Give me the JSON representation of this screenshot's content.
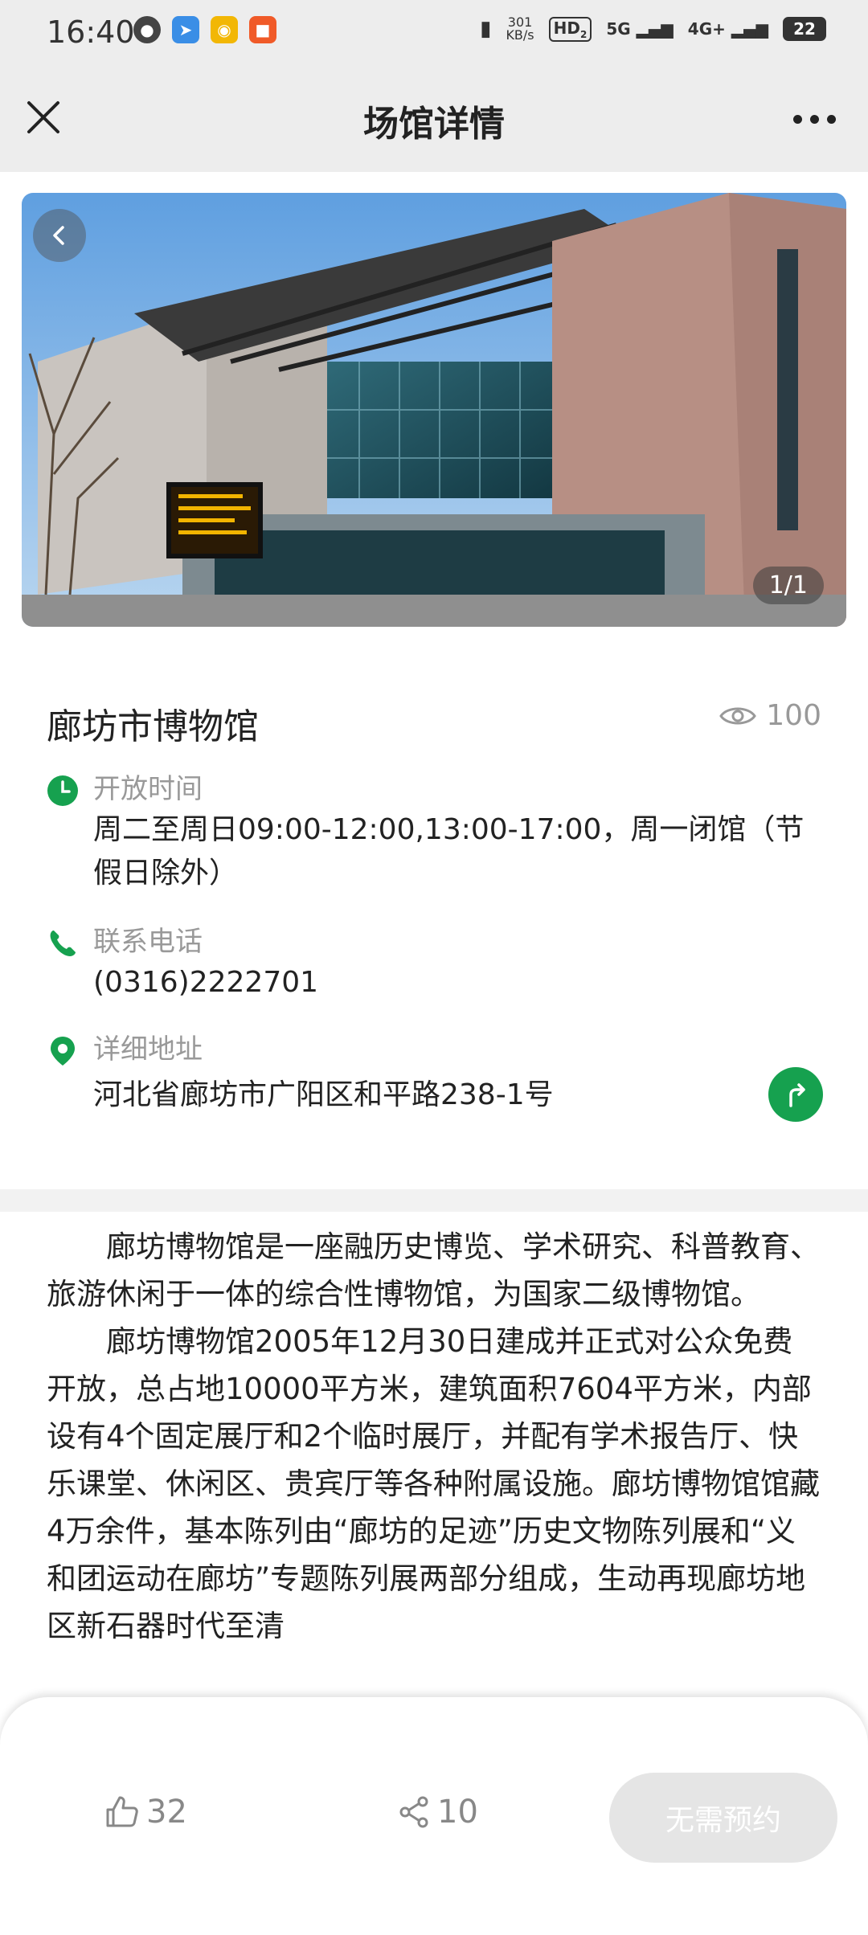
{
  "status_bar": {
    "time": "16:40",
    "net_speed_value": "301",
    "net_speed_unit": "KB/s",
    "hd_label": "HD",
    "hd_sub": "2",
    "sig1": "5G",
    "sig2": "4G+",
    "battery": "22"
  },
  "nav": {
    "title": "场馆详情"
  },
  "hero": {
    "counter": "1/1"
  },
  "venue": {
    "name": "廊坊市博物馆",
    "views": "100",
    "hours_label": "开放时间",
    "hours_value": "周二至周日09:00-12:00,13:00-17:00，周一闭馆（节假日除外）",
    "phone_label": "联系电话",
    "phone_value": "(0316)2222701",
    "address_label": "详细地址",
    "address_value": "河北省廊坊市广阳区和平路238-1号"
  },
  "description": {
    "p1": "廊坊博物馆是一座融历史博览、学术研究、科普教育、旅游休闲于一体的综合性博物馆，为国家二级博物馆。",
    "p2": "廊坊博物馆2005年12月30日建成并正式对公众免费开放，总占地10000平方米，建筑面积7604平方米，内部设有4个固定展厅和2个临时展厅，并配有学术报告厅、快乐课堂、休闲区、贵宾厅等各种附属设施。廊坊博物馆馆藏4万余件，基本陈列由“廊坊的足迹”历史文物陈列展和“义和团运动在廊坊”专题陈列展两部分组成，生动再现廊坊地区新石器时代至清"
  },
  "bottom": {
    "likes": "32",
    "shares": "10",
    "reserve": "无需预约"
  },
  "colors": {
    "accent_green": "#16a14f",
    "nav_bg": "#ededed"
  }
}
